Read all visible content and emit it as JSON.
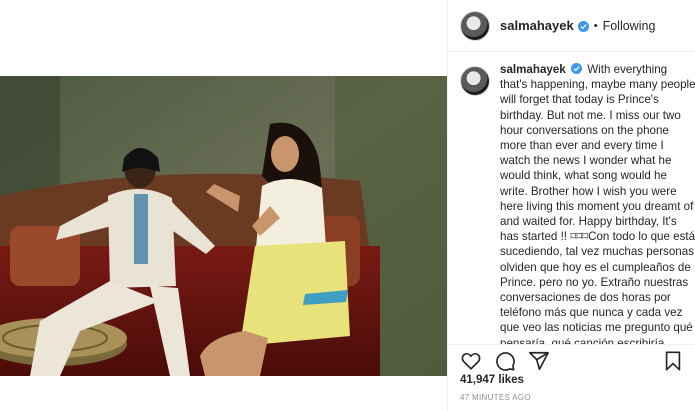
{
  "post": {
    "username": "salmahayek",
    "follow_status": "Following",
    "separator": "•",
    "caption": "With everything that's happening, maybe many people will forget that today is Prince's birthday. But not me. I miss our two hour conversations on the phone more than ever and every time I watch the news I wonder what he would think, what song would he write. Brother how I wish you were here living this moment you dreamt of and waited for. Happy birthday, It's has started !! ⌑⌑⌑Con todo lo que está sucediendo, tal vez muchas personas olviden que hoy es el cumpleaños de Prince. pero no yo. Extraño nuestras conversaciones de dos horas por teléfono más que nunca y cada vez que veo las noticias me pregunto qué pensaría, qué canción escribiría. Hermano, cómo me gustaría que estuvieras aquí viviendo este",
    "likes": "41,947 likes",
    "timestamp": "47 MINUTES AGO"
  },
  "icons": {
    "verified": "verified-badge-icon",
    "like": "heart-icon",
    "comment": "comment-icon",
    "share": "share-icon",
    "save": "bookmark-icon"
  },
  "colors": {
    "verified_blue": "#3897f0",
    "text": "#262626",
    "secondary_text": "#8e8e8e",
    "divider": "#efefef"
  }
}
